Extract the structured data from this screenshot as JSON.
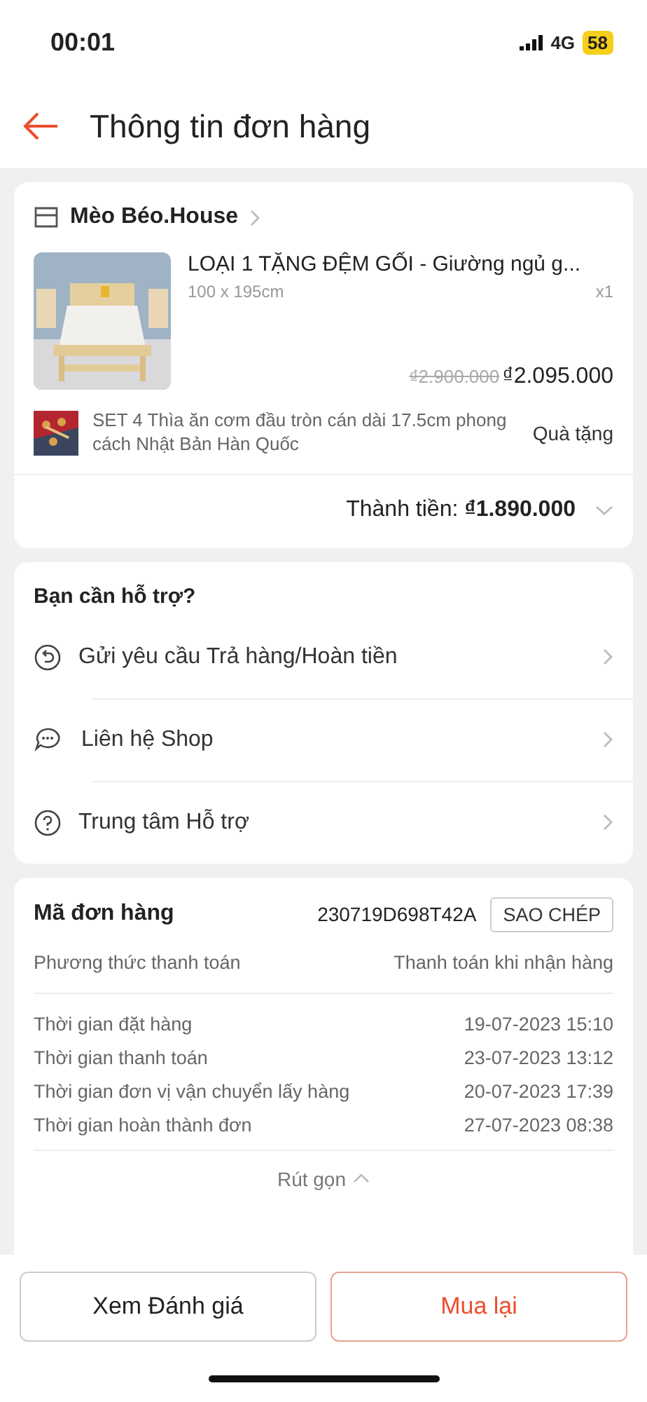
{
  "status_bar": {
    "time": "00:01",
    "network": "4G",
    "battery": "58"
  },
  "header": {
    "title": "Thông tin đơn hàng"
  },
  "order": {
    "shop": "Mèo Béo.House",
    "product": {
      "name": "LOẠI 1 TẶNG ĐỆM GỐI - Giường ngủ g...",
      "variant": "100 x 195cm",
      "quantity": "x1",
      "original_price": "₫2.900.000",
      "price": "₫2.095.000"
    },
    "gift": {
      "name": "SET 4 Thìa ăn cơm đầu tròn cán dài 17.5cm phong cách Nhật Bản Hàn Quốc",
      "tag": "Quà tặng"
    },
    "total_label": "Thành tiền:",
    "total": "₫1.890.000"
  },
  "support": {
    "title": "Bạn cần hỗ trợ?",
    "items": [
      {
        "kind": "return",
        "label": "Gửi yêu cầu Trả hàng/Hoàn tiền"
      },
      {
        "kind": "chat",
        "label": "Liên hệ Shop"
      },
      {
        "kind": "help",
        "label": "Trung tâm Hỗ trợ"
      }
    ]
  },
  "details": {
    "order_id_label": "Mã đơn hàng",
    "order_id": "230719D698T42A",
    "copy_button": "SAO CHÉP",
    "payment": {
      "label": "Phương thức thanh toán",
      "value": "Thanh toán khi nhận hàng"
    },
    "times": [
      {
        "label": "Thời gian đặt hàng",
        "value": "19-07-2023 15:10"
      },
      {
        "label": "Thời gian thanh toán",
        "value": "23-07-2023 13:12"
      },
      {
        "label": "Thời gian đơn vị vận chuyển lấy hàng",
        "value": "20-07-2023 17:39"
      },
      {
        "label": "Thời gian hoàn thành đơn",
        "value": "27-07-2023 08:38"
      }
    ],
    "collapse": "Rút gọn"
  },
  "actions": [
    {
      "kind": "secondary",
      "label": "Xem Đánh giá"
    },
    {
      "kind": "primary",
      "label": "Mua lại"
    }
  ]
}
